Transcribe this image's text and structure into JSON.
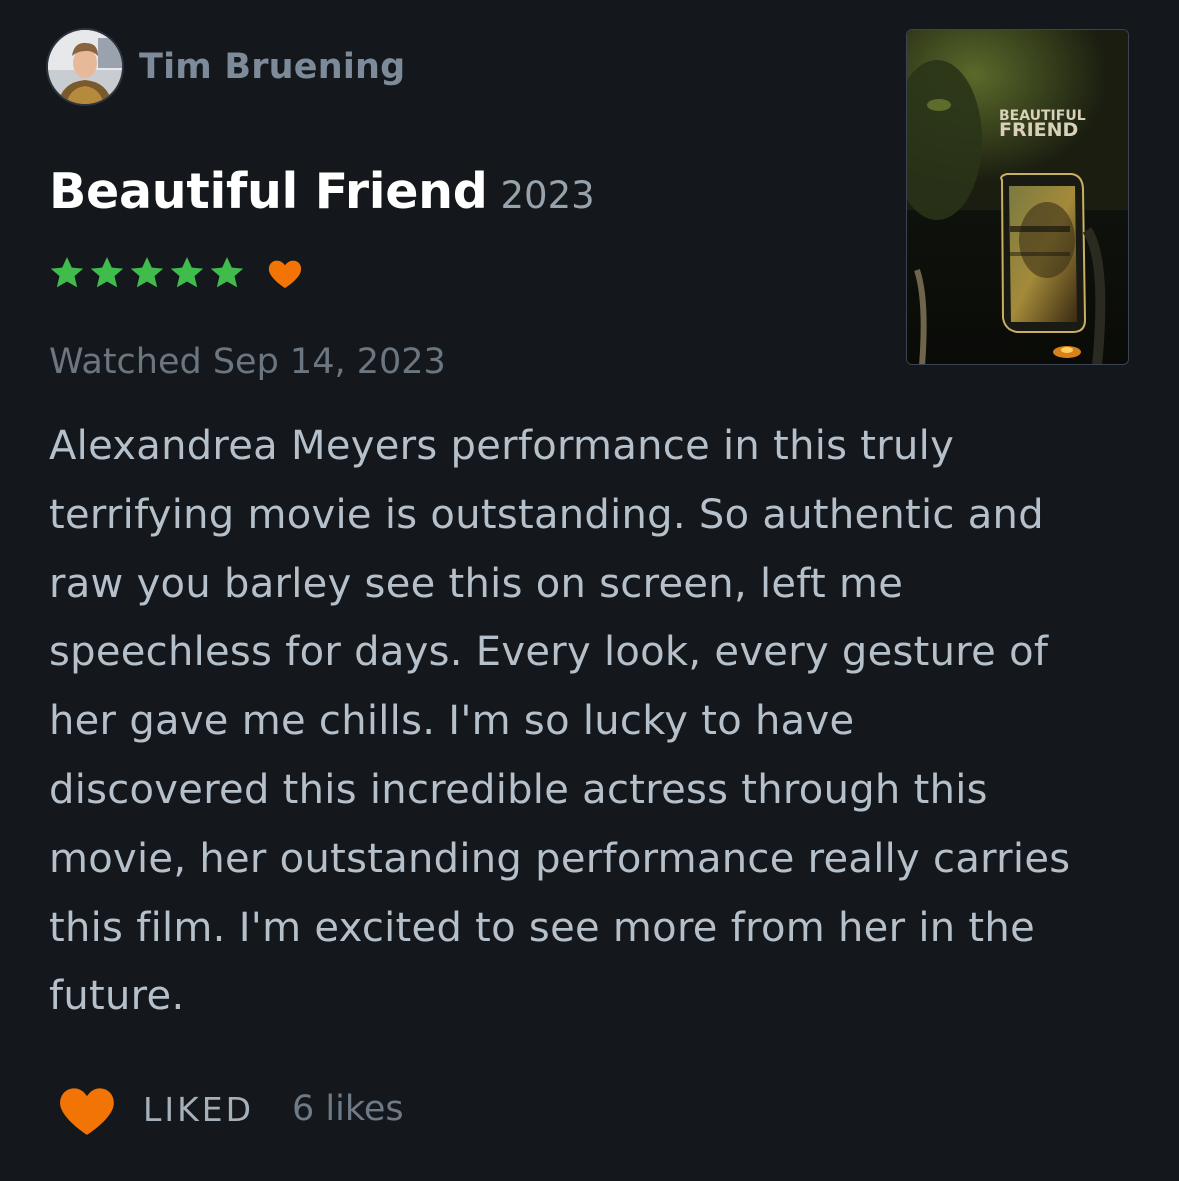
{
  "author": {
    "name": "Tim Bruening"
  },
  "film": {
    "title": "Beautiful Friend",
    "year": "2023",
    "poster_title_line1": "BEAUTIFUL",
    "poster_title_line2": "FRIEND"
  },
  "rating": {
    "stars": 5,
    "max_stars": 5,
    "liked": true,
    "star_color": "#40bc4d",
    "heart_color": "#f27405"
  },
  "watched": "Watched Sep 14, 2023",
  "review": {
    "lines": [
      "Alexandrea Meyers performance in this truly",
      "terrifying movie is outstanding. So authentic and",
      "raw you barley see this on screen, left me",
      "speechless for days. Every look, every gesture of",
      "her gave me chills. I'm so lucky to have",
      "discovered this incredible actress through this",
      "movie, her outstanding performance really carries",
      "this film. I'm excited to see more from her in the",
      "future."
    ]
  },
  "footer": {
    "liked_label": "LIKED",
    "likes_count": "6 likes"
  },
  "icons": {
    "star": "star-icon",
    "heart": "heart-icon"
  }
}
